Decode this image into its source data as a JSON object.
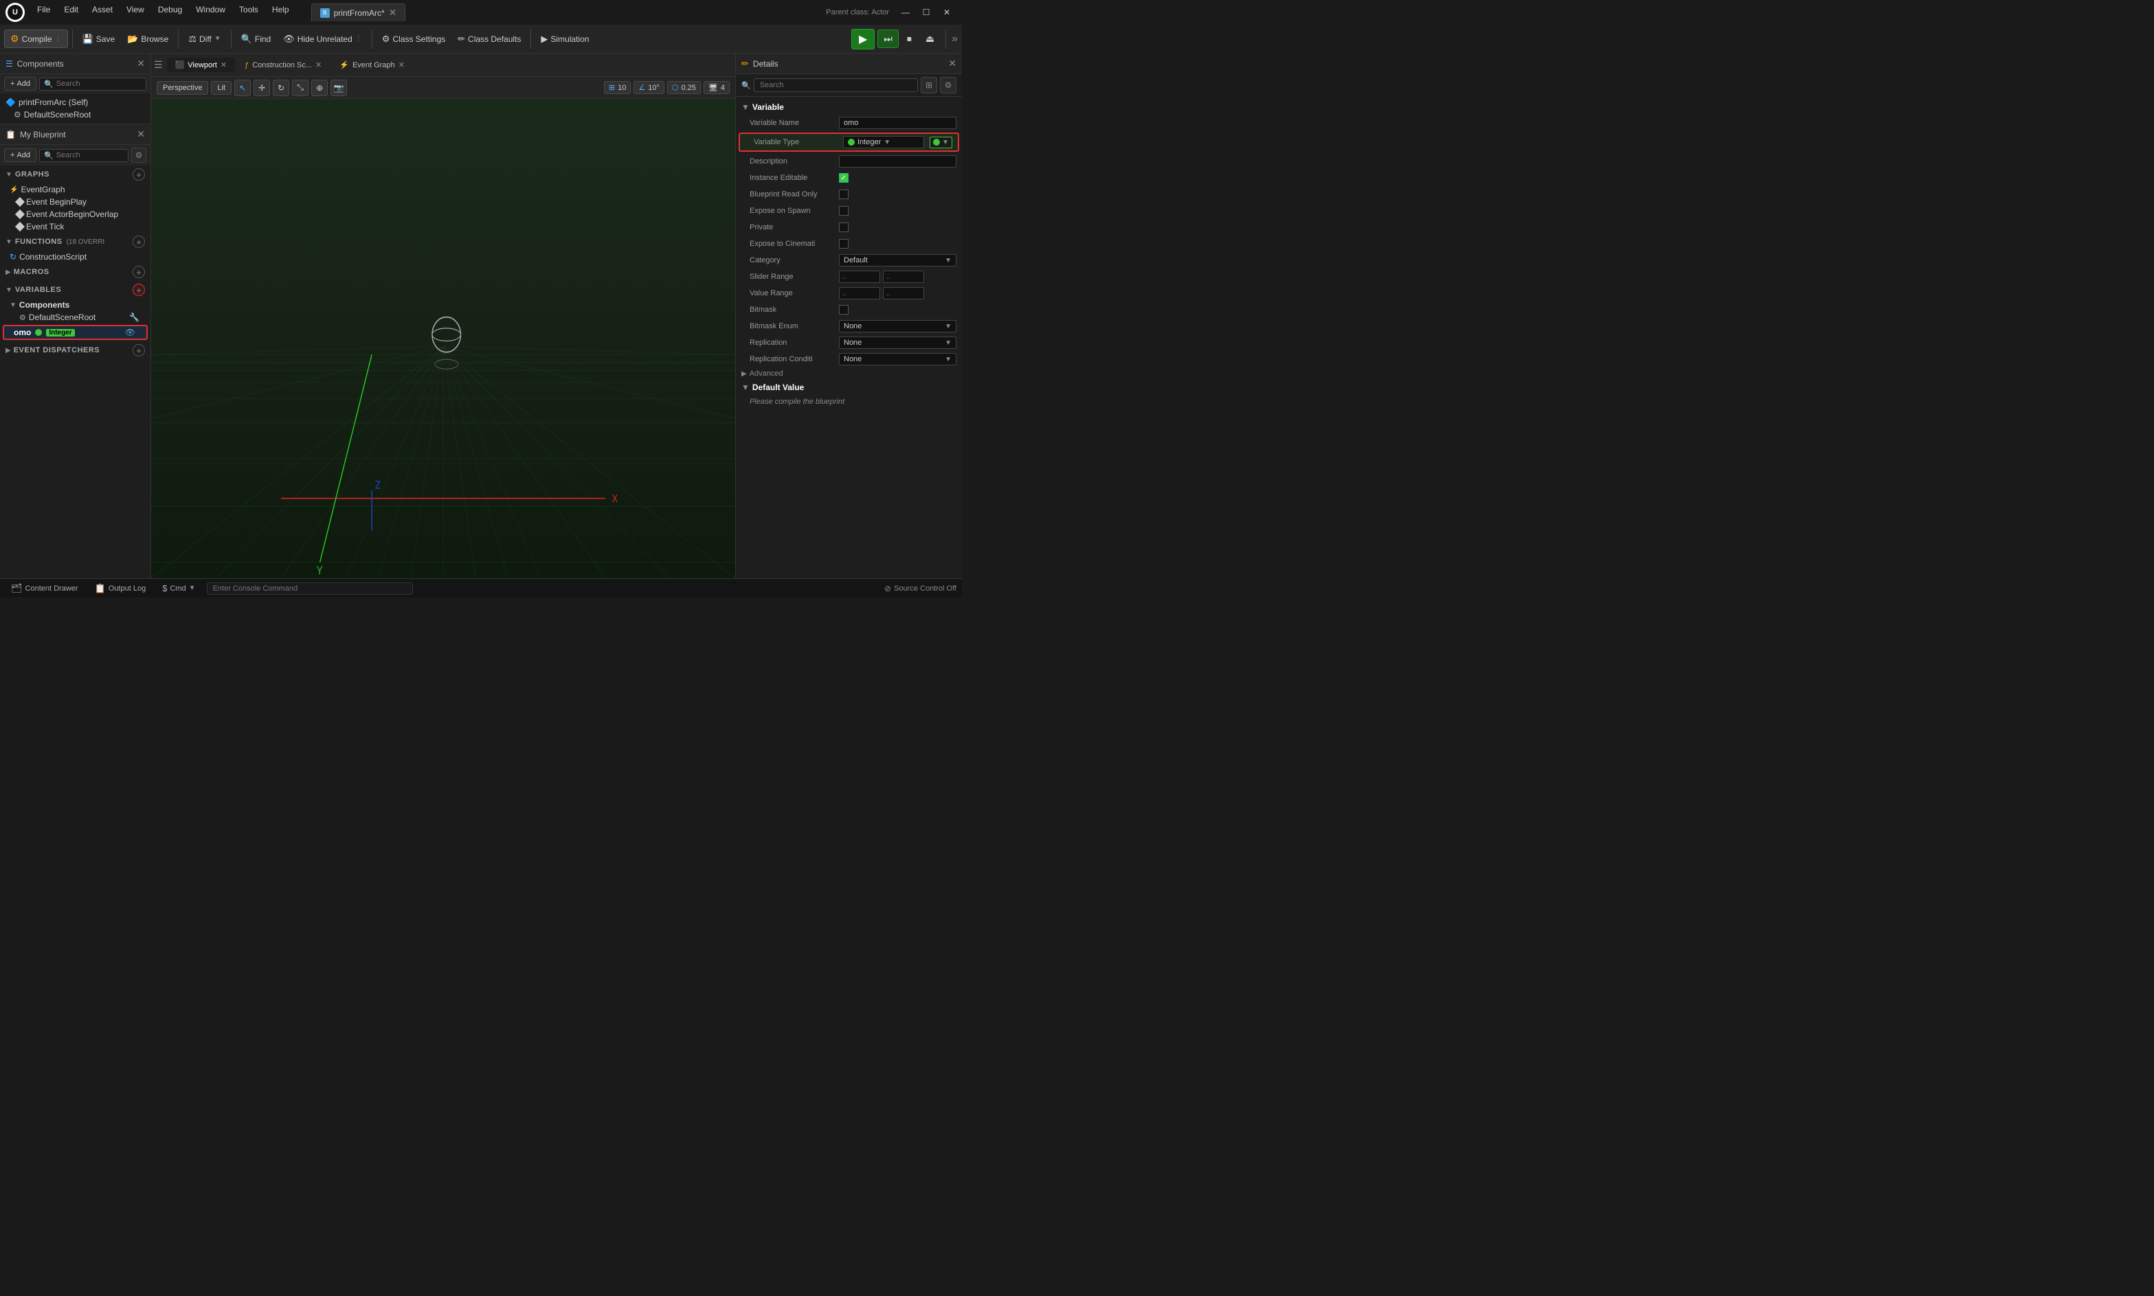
{
  "titlebar": {
    "menus": [
      "File",
      "Edit",
      "Asset",
      "View",
      "Debug",
      "Window",
      "Tools",
      "Help"
    ],
    "tab_label": "printFromArc*",
    "parent_class_label": "Parent class: Actor",
    "window_controls": [
      "—",
      "☐",
      "✕"
    ]
  },
  "toolbar": {
    "compile_label": "Compile",
    "save_label": "Save",
    "browse_label": "Browse",
    "diff_label": "Diff",
    "find_label": "Find",
    "hide_unrelated_label": "Hide Unrelated",
    "class_settings_label": "Class Settings",
    "class_defaults_label": "Class Defaults",
    "simulation_label": "Simulation"
  },
  "components_panel": {
    "title": "Components",
    "add_label": "+ Add",
    "search_placeholder": "Search",
    "items": [
      {
        "name": "printFromArc (Self)",
        "icon": "🔷",
        "indent": 0
      },
      {
        "name": "DefaultSceneRoot",
        "icon": "⚙",
        "indent": 1
      }
    ]
  },
  "blueprint_panel": {
    "title": "My Blueprint",
    "add_label": "+ Add",
    "search_placeholder": "Search",
    "graphs": {
      "label": "GRAPHS",
      "items": [
        {
          "name": "EventGraph",
          "icon": "graph"
        },
        {
          "name": "Event BeginPlay",
          "icon": "diamond"
        },
        {
          "name": "Event ActorBeginOverlap",
          "icon": "diamond"
        },
        {
          "name": "Event Tick",
          "icon": "diamond"
        }
      ]
    },
    "functions": {
      "label": "FUNCTIONS",
      "badge": "18 OVERRI",
      "items": [
        {
          "name": "ConstructionScript",
          "icon": "refresh"
        }
      ]
    },
    "macros": {
      "label": "MACROS",
      "items": []
    },
    "variables": {
      "label": "VARIABLES",
      "categories": [
        {
          "name": "Components",
          "items": [
            {
              "name": "DefaultSceneRoot",
              "icon": "comp",
              "extra": "🔧"
            }
          ]
        },
        {
          "name": "omo",
          "type": "Integer",
          "selected": true
        }
      ]
    },
    "event_dispatchers": {
      "label": "EVENT DISPATCHERS",
      "items": []
    }
  },
  "viewport": {
    "tabs": [
      {
        "label": "Viewport",
        "active": false
      },
      {
        "label": "Construction Sc...",
        "active": false
      },
      {
        "label": "Event Graph",
        "active": false
      }
    ],
    "perspective_label": "Perspective",
    "lit_label": "Lit"
  },
  "details_panel": {
    "title": "Details",
    "search_placeholder": "Search",
    "variable_section": "Variable",
    "fields": [
      {
        "key": "variable_name_label",
        "value": "Variable Name",
        "input": "omo"
      },
      {
        "key": "variable_type_label",
        "value": "Variable Type",
        "type_name": "Integer",
        "highlighted": true
      },
      {
        "key": "description_label",
        "value": "Description",
        "input": ""
      },
      {
        "key": "instance_editable_label",
        "value": "Instance Editable",
        "checked": true
      },
      {
        "key": "blueprint_read_only_label",
        "value": "Blueprint Read Only",
        "checked": false
      },
      {
        "key": "expose_on_spawn_label",
        "value": "Expose on Spawn",
        "checked": false
      },
      {
        "key": "private_label",
        "value": "Private",
        "checked": false
      },
      {
        "key": "expose_to_cinemati_label",
        "value": "Expose to Cinemati",
        "checked": false
      },
      {
        "key": "category_label",
        "value": "Category",
        "dropdown": "Default"
      },
      {
        "key": "slider_range_label",
        "value": "Slider Range"
      },
      {
        "key": "value_range_label",
        "value": "Value Range"
      },
      {
        "key": "bitmask_label",
        "value": "Bitmask",
        "checked": false
      },
      {
        "key": "bitmask_enum_label",
        "value": "Bitmask Enum",
        "dropdown": "None"
      },
      {
        "key": "replication_label",
        "value": "Replication",
        "dropdown": "None"
      },
      {
        "key": "replication_conditi_label",
        "value": "Replication Conditi",
        "dropdown": "None"
      }
    ],
    "advanced_label": "Advanced",
    "default_value_section": "Default Value",
    "compile_note": "Please compile the blueprint"
  },
  "status_bar": {
    "content_drawer_label": "Content Drawer",
    "output_log_label": "Output Log",
    "cmd_label": "Cmd",
    "console_placeholder": "Enter Console Command",
    "source_control_label": "Source Control Off"
  }
}
